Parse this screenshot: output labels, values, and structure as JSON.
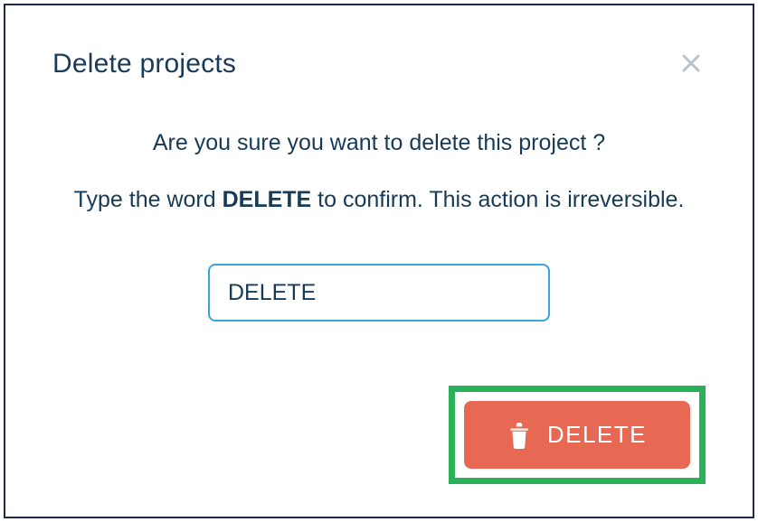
{
  "modal": {
    "title": "Delete projects",
    "question": "Are you sure you want to delete this project ?",
    "instruction_before": "Type the word ",
    "instruction_bold": "DELETE",
    "instruction_after": " to confirm. This action is irreversible.",
    "input_value": "DELETE",
    "delete_button_label": "DELETE"
  }
}
